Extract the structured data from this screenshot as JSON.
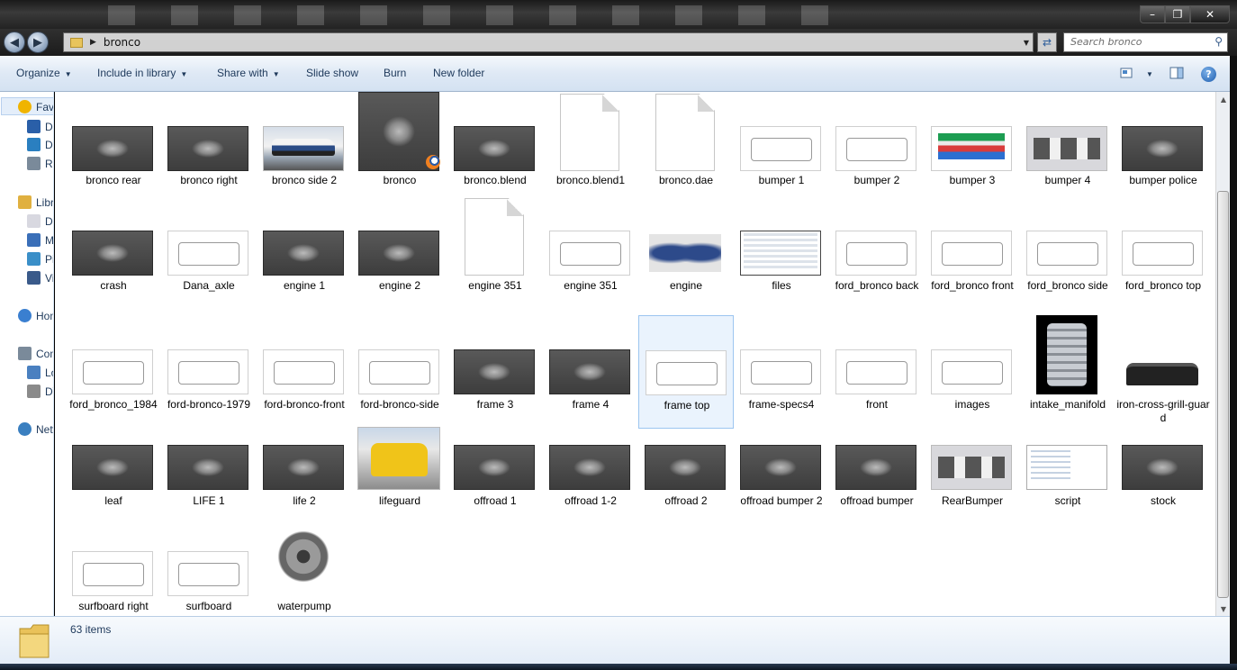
{
  "window": {
    "minimize_icon": "minimize-icon",
    "maximize_icon": "maximize-icon",
    "close_icon": "close-icon"
  },
  "address": {
    "path": "bronco",
    "search_placeholder": "Search bronco"
  },
  "toolbar": {
    "organize": "Organize",
    "include_in_library": "Include in library",
    "share_with": "Share with",
    "slide_show": "Slide show",
    "burn": "Burn",
    "new_folder": "New folder"
  },
  "nav": {
    "items": [
      {
        "label": "Favorites",
        "icon": "star-icon"
      },
      {
        "label": "Desktop",
        "icon": "desktop-icon"
      },
      {
        "label": "Downloads",
        "icon": "downloads-icon"
      },
      {
        "label": "Recent Places",
        "icon": "recent-icon"
      },
      {
        "label": "Libraries",
        "icon": "library-icon"
      },
      {
        "label": "Documents",
        "icon": "documents-icon"
      },
      {
        "label": "Music",
        "icon": "music-icon"
      },
      {
        "label": "Pictures",
        "icon": "pictures-icon"
      },
      {
        "label": "Videos",
        "icon": "videos-icon"
      },
      {
        "label": "Homegroup",
        "icon": "homegroup-icon"
      },
      {
        "label": "Computer",
        "icon": "computer-icon"
      },
      {
        "label": "Local Disk (C:)",
        "icon": "windows-drive-icon"
      },
      {
        "label": "DVD Drive",
        "icon": "drive-icon"
      },
      {
        "label": "Network",
        "icon": "network-icon"
      }
    ]
  },
  "files": [
    {
      "name": "bronco rear",
      "thumb": "dark"
    },
    {
      "name": "bronco right",
      "thumb": "dark"
    },
    {
      "name": "bronco side 2",
      "thumb": "photo"
    },
    {
      "name": "bronco",
      "thumb": "blender"
    },
    {
      "name": "bronco.blend",
      "thumb": "dark"
    },
    {
      "name": "bronco.blend1",
      "thumb": "doc"
    },
    {
      "name": "bronco.dae",
      "thumb": "doc"
    },
    {
      "name": "bumper 1",
      "thumb": "light"
    },
    {
      "name": "bumper 2",
      "thumb": "light"
    },
    {
      "name": "bumper 3",
      "thumb": "colorbp"
    },
    {
      "name": "bumper 4",
      "thumb": "grey"
    },
    {
      "name": "bumper police",
      "thumb": "dark"
    },
    {
      "name": "crash",
      "thumb": "dark"
    },
    {
      "name": "Dana_axle",
      "thumb": "light"
    },
    {
      "name": "engine 1",
      "thumb": "dark"
    },
    {
      "name": "engine 2",
      "thumb": "dark"
    },
    {
      "name": "engine 351",
      "thumb": "doc"
    },
    {
      "name": "engine 351",
      "thumb": "light"
    },
    {
      "name": "engine",
      "thumb": "engine"
    },
    {
      "name": "files",
      "thumb": "screen"
    },
    {
      "name": "ford_bronco back",
      "thumb": "light"
    },
    {
      "name": "ford_bronco front",
      "thumb": "light"
    },
    {
      "name": "ford_bronco side",
      "thumb": "light"
    },
    {
      "name": "ford_bronco top",
      "thumb": "light"
    },
    {
      "name": "ford_bronco_1984",
      "thumb": "light"
    },
    {
      "name": "ford-bronco-1979",
      "thumb": "light"
    },
    {
      "name": "ford-bronco-front",
      "thumb": "light"
    },
    {
      "name": "ford-bronco-side",
      "thumb": "light"
    },
    {
      "name": "frame 3",
      "thumb": "dark"
    },
    {
      "name": "frame 4",
      "thumb": "dark"
    },
    {
      "name": "frame top",
      "thumb": "light",
      "selected": true
    },
    {
      "name": "frame-specs4",
      "thumb": "light"
    },
    {
      "name": "front",
      "thumb": "light"
    },
    {
      "name": "images",
      "thumb": "light"
    },
    {
      "name": "intake_manifold",
      "thumb": "black"
    },
    {
      "name": "iron-cross-grill-guard",
      "thumb": "bumperdark"
    },
    {
      "name": "leaf",
      "thumb": "dark"
    },
    {
      "name": "LIFE 1",
      "thumb": "dark"
    },
    {
      "name": "life 2",
      "thumb": "dark"
    },
    {
      "name": "lifeguard",
      "thumb": "yellow"
    },
    {
      "name": "offroad 1",
      "thumb": "dark"
    },
    {
      "name": "offroad 1-2",
      "thumb": "dark"
    },
    {
      "name": "offroad 2",
      "thumb": "dark"
    },
    {
      "name": "offroad bumper 2",
      "thumb": "dark"
    },
    {
      "name": "offroad bumper",
      "thumb": "dark"
    },
    {
      "name": "RearBumper",
      "thumb": "grey"
    },
    {
      "name": "script",
      "thumb": "white"
    },
    {
      "name": "stock",
      "thumb": "dark"
    },
    {
      "name": "surfboard right",
      "thumb": "light"
    },
    {
      "name": "surfboard",
      "thumb": "light"
    },
    {
      "name": "waterpump",
      "thumb": "pump"
    }
  ],
  "status": {
    "count": "63 items"
  }
}
